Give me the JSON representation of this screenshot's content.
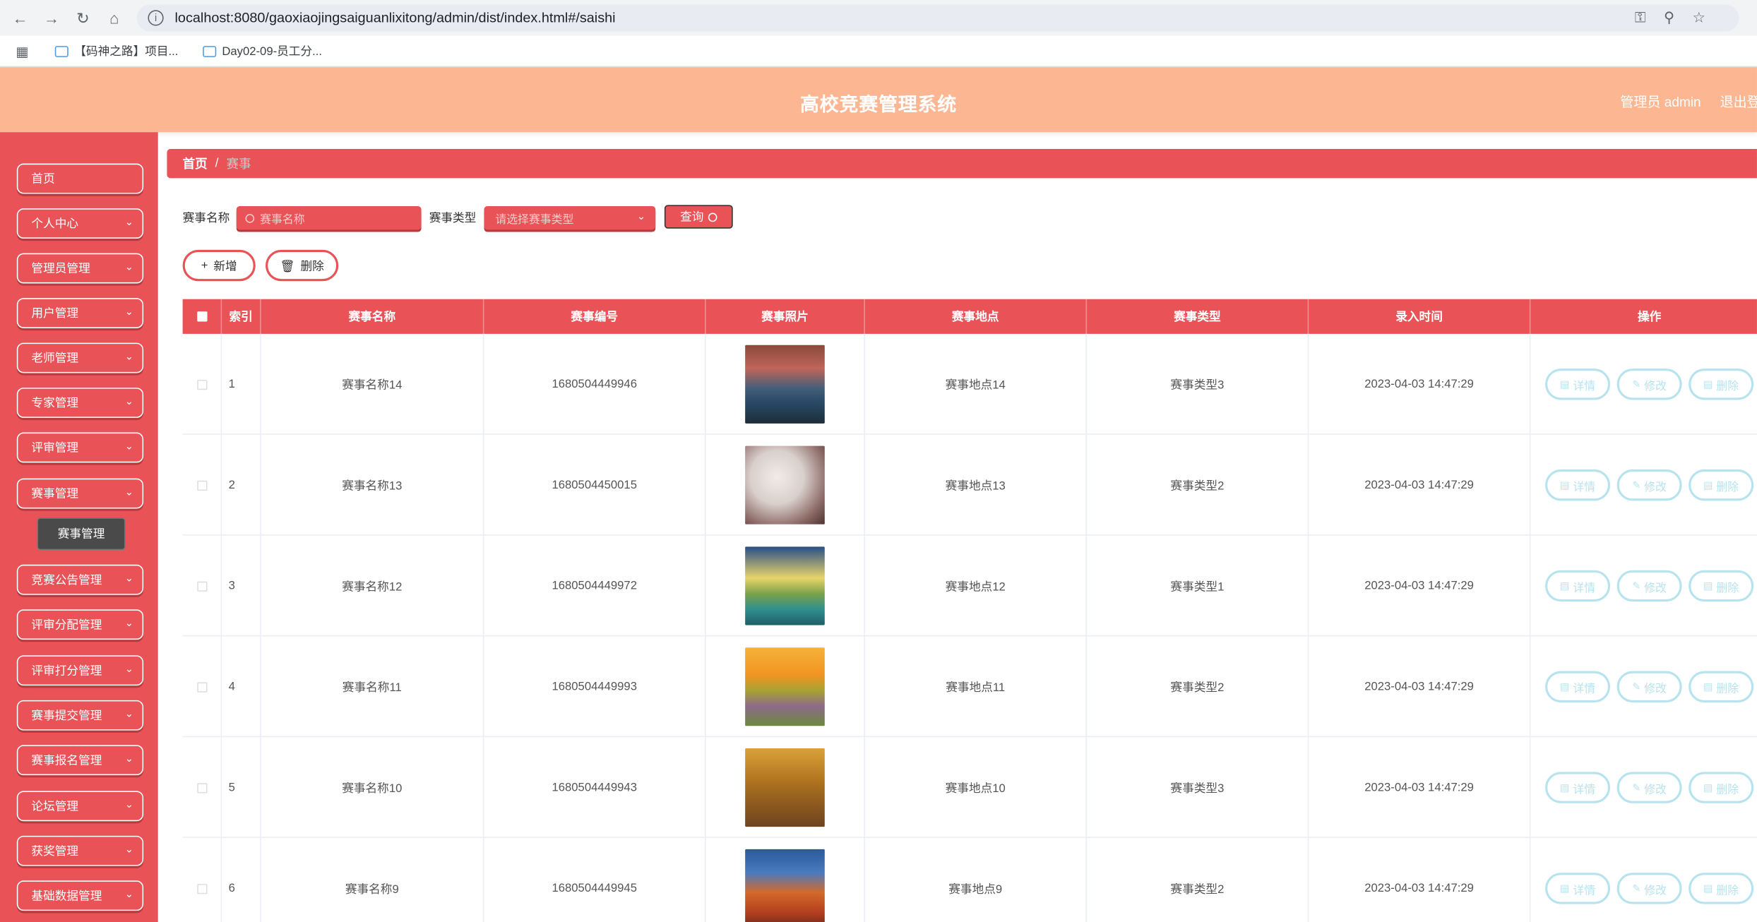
{
  "browser": {
    "url": "localhost:8080/gaoxiaojingsaiguanlixitong/admin/dist/index.html#/saishi",
    "bookmarks": [
      "【码神之路】项目...",
      "Day02-09-员工分..."
    ]
  },
  "header": {
    "title": "高校竞赛管理系统",
    "user": "管理员 admin",
    "logout": "退出登"
  },
  "sidebar": {
    "items": [
      {
        "label": "首页"
      },
      {
        "label": "个人中心"
      },
      {
        "label": "管理员管理"
      },
      {
        "label": "用户管理"
      },
      {
        "label": "老师管理"
      },
      {
        "label": "专家管理"
      },
      {
        "label": "评审管理"
      },
      {
        "label": "赛事管理"
      },
      {
        "label": "竞赛公告管理"
      },
      {
        "label": "评审分配管理"
      },
      {
        "label": "评审打分管理"
      },
      {
        "label": "赛事提交管理"
      },
      {
        "label": "赛事报名管理"
      },
      {
        "label": "论坛管理"
      },
      {
        "label": "获奖管理"
      },
      {
        "label": "基础数据管理"
      }
    ],
    "active_sub": "赛事管理"
  },
  "breadcrumb": {
    "home": "首页",
    "sep": "/",
    "current": "赛事"
  },
  "search": {
    "name_label": "赛事名称",
    "name_placeholder": "赛事名称",
    "type_label": "赛事类型",
    "type_placeholder": "请选择赛事类型",
    "query_label": "查询"
  },
  "toolbar": {
    "add_label": "新增",
    "delete_label": "删除"
  },
  "table": {
    "headers": [
      "索引",
      "赛事名称",
      "赛事编号",
      "赛事照片",
      "赛事地点",
      "赛事类型",
      "录入时间",
      "操作"
    ],
    "actions": {
      "detail": "详情",
      "edit": "修改",
      "delete": "删除"
    },
    "rows": [
      {
        "index": "1",
        "name": "赛事名称14",
        "code": "1680504449946",
        "place": "赛事地点14",
        "type": "赛事类型3",
        "time": "2023-04-03 14:47:29",
        "photo": "lake-sunset"
      },
      {
        "index": "2",
        "name": "赛事名称13",
        "code": "1680504450015",
        "place": "赛事地点13",
        "type": "赛事类型2",
        "time": "2023-04-03 14:47:29",
        "photo": "blossom"
      },
      {
        "index": "3",
        "name": "赛事名称12",
        "code": "1680504449972",
        "place": "赛事地点12",
        "type": "赛事类型1",
        "time": "2023-04-03 14:47:29",
        "photo": "sunrise-lake"
      },
      {
        "index": "4",
        "name": "赛事名称11",
        "code": "1680504449993",
        "place": "赛事地点11",
        "type": "赛事类型2",
        "time": "2023-04-03 14:47:29",
        "photo": "flower-field"
      },
      {
        "index": "5",
        "name": "赛事名称10",
        "code": "1680504449943",
        "place": "赛事地点10",
        "type": "赛事类型3",
        "time": "2023-04-03 14:47:29",
        "photo": "autumn-road"
      },
      {
        "index": "6",
        "name": "赛事名称9",
        "code": "1680504449945",
        "place": "赛事地点9",
        "type": "赛事类型2",
        "time": "2023-04-03 14:47:29",
        "photo": "red-rock"
      }
    ]
  },
  "colors": {
    "primary": "#e95256",
    "header": "#fdb692",
    "action": "#b7e3ee"
  }
}
